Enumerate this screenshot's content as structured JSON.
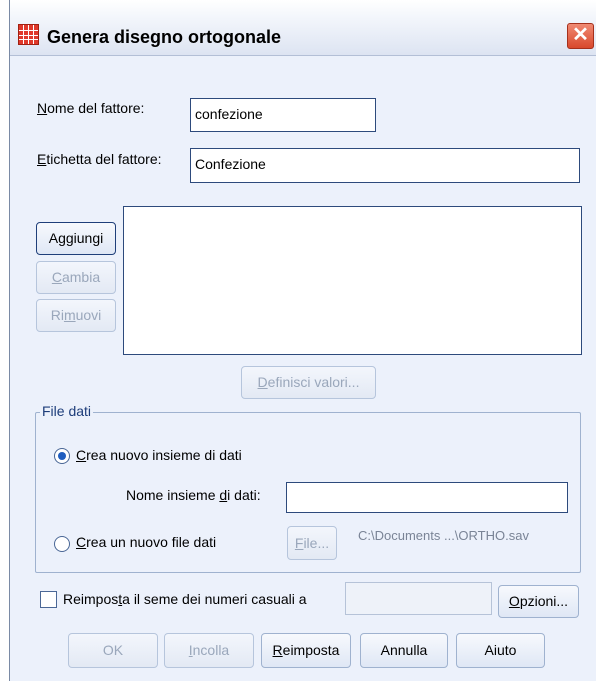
{
  "window": {
    "title": "Genera disegno ortogonale"
  },
  "factor_name": {
    "label": "Nome del fattore:",
    "value": "confezione"
  },
  "factor_label": {
    "label": "Etichetta del fattore:",
    "value": "Confezione"
  },
  "factor_buttons": {
    "add": "Aggiungi",
    "change": "Cambia",
    "remove": "Rimuovi"
  },
  "define_values_button": "Definisci valori...",
  "data_file": {
    "group_title": "File dati",
    "new_dataset_option": "Crea nuovo insieme di dati",
    "dataset_name_label": "Nome insieme di dati:",
    "dataset_name_value": "",
    "new_file_option": "Crea un nuovo file dati",
    "file_button": "File...",
    "file_path": "C:\\Documents ...\\ORTHO.sav"
  },
  "reset_seed": {
    "label": "Reimposta il seme dei numeri casuali a",
    "value": "",
    "checked": false
  },
  "options_button": "Opzioni...",
  "footer": {
    "ok": "OK",
    "paste": "Incolla",
    "reset": "Reimposta",
    "cancel": "Annulla",
    "help": "Aiuto"
  }
}
